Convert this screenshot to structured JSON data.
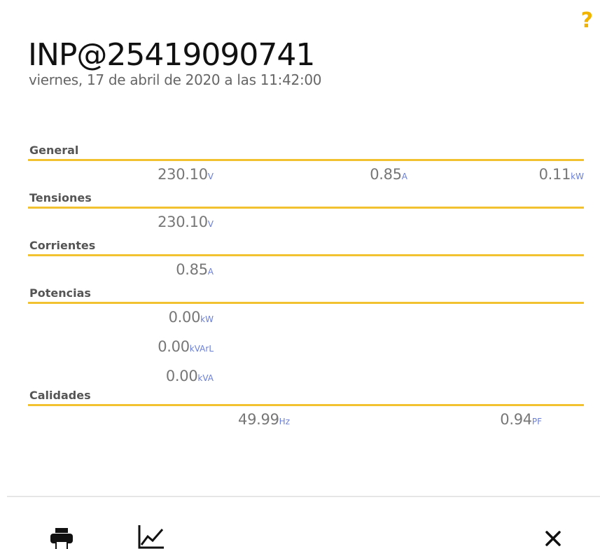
{
  "header": {
    "help_label": "?",
    "title": "INP@25419090741",
    "timestamp": "viernes, 17 de abril de 2020 a las 11:42:00"
  },
  "sections": {
    "general": {
      "label": "General",
      "voltage": {
        "value": "230.10",
        "unit": "V"
      },
      "current": {
        "value": "0.85",
        "unit": "A"
      },
      "power": {
        "value": "0.11",
        "unit": "kW"
      }
    },
    "tensiones": {
      "label": "Tensiones",
      "voltage": {
        "value": "230.10",
        "unit": "V"
      }
    },
    "corrientes": {
      "label": "Corrientes",
      "current": {
        "value": "0.85",
        "unit": "A"
      }
    },
    "potencias": {
      "label": "Potencias",
      "active": {
        "value": "0.00",
        "unit": "kW"
      },
      "reactive": {
        "value": "0.00",
        "unit": "kVArL"
      },
      "apparent": {
        "value": "0.00",
        "unit": "kVA"
      }
    },
    "calidades": {
      "label": "Calidades",
      "frequency": {
        "value": "49.99",
        "unit": "Hz"
      },
      "power_factor": {
        "value": "0.94",
        "unit": "PF"
      }
    }
  },
  "toolbar": {
    "print_icon": "print-icon",
    "chart_icon": "chart-line-icon",
    "close_icon": "close-icon"
  },
  "colors": {
    "accent": "#f2c230",
    "unit": "#6b7fd6",
    "help": "#f0b400"
  }
}
